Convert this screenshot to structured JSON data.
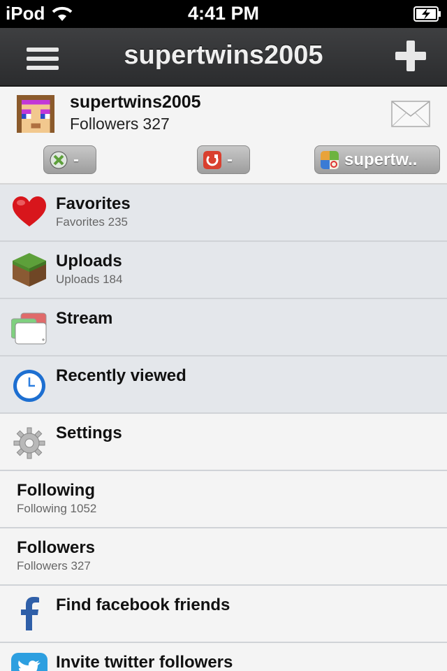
{
  "status_bar": {
    "carrier": "iPod",
    "time": "4:41 PM"
  },
  "nav": {
    "title": "supertwins2005",
    "menu_icon": "hamburger-menu-icon",
    "add_icon": "plus-icon"
  },
  "profile": {
    "username": "supertwins2005",
    "followers_label": "Followers",
    "followers_count": "327",
    "accounts": [
      {
        "icon": "xbox-icon",
        "label": "-"
      },
      {
        "icon": "minecraft-pe-icon",
        "label": "-"
      },
      {
        "icon": "game-center-icon",
        "label": "supertw.."
      }
    ]
  },
  "menu": [
    {
      "title": "Favorites",
      "subtitle": "Favorites 235",
      "icon": "heart-icon"
    },
    {
      "title": "Uploads",
      "subtitle": "Uploads 184",
      "icon": "grass-block-icon"
    },
    {
      "title": "Stream",
      "subtitle": "",
      "icon": "stream-icon"
    },
    {
      "title": "Recently viewed",
      "subtitle": "",
      "icon": "clock-icon"
    },
    {
      "title": "Settings",
      "subtitle": "",
      "icon": "gear-icon"
    },
    {
      "title": "Following",
      "subtitle": "Following 1052"
    },
    {
      "title": "Followers",
      "subtitle": "Followers 327"
    },
    {
      "title": "Find facebook friends",
      "subtitle": "",
      "icon": "facebook-icon"
    },
    {
      "title": "Invite twitter followers",
      "subtitle": "",
      "icon": "twitter-icon"
    }
  ],
  "colors": {
    "nav_bg": "#2f3032",
    "shaded_row": "#e4e7eb",
    "plain_row": "#f4f4f4"
  }
}
